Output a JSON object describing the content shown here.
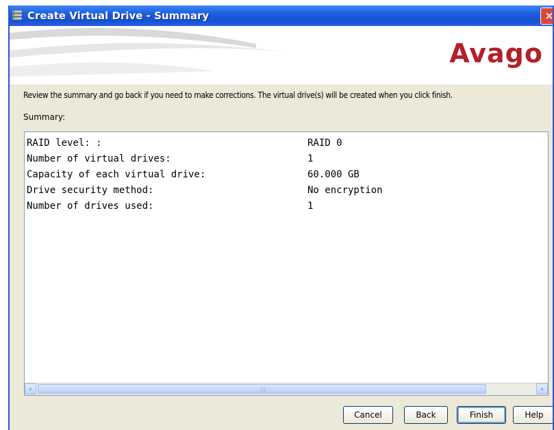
{
  "window": {
    "title": "Create Virtual Drive - Summary",
    "close_label": "×"
  },
  "banner": {
    "logo": "Avago"
  },
  "instructions": "Review the summary and go back if you need to make corrections. The virtual drive(s) will be created when you click finish.",
  "summary_label": "Summary:",
  "summary_rows": [
    {
      "key": "RAID level: :",
      "value": "RAID 0"
    },
    {
      "key": "Number of virtual drives:",
      "value": "1"
    },
    {
      "key": "Capacity of each virtual drive:",
      "value": "60.000 GB"
    },
    {
      "key": "Drive security method:",
      "value": "No encryption"
    },
    {
      "key": "Number of drives used:",
      "value": "1"
    }
  ],
  "buttons": {
    "cancel": "Cancel",
    "back": "Back",
    "finish": "Finish",
    "help": "Help"
  },
  "scrollbar": {
    "left_arrow": "‹",
    "right_arrow": "›"
  }
}
